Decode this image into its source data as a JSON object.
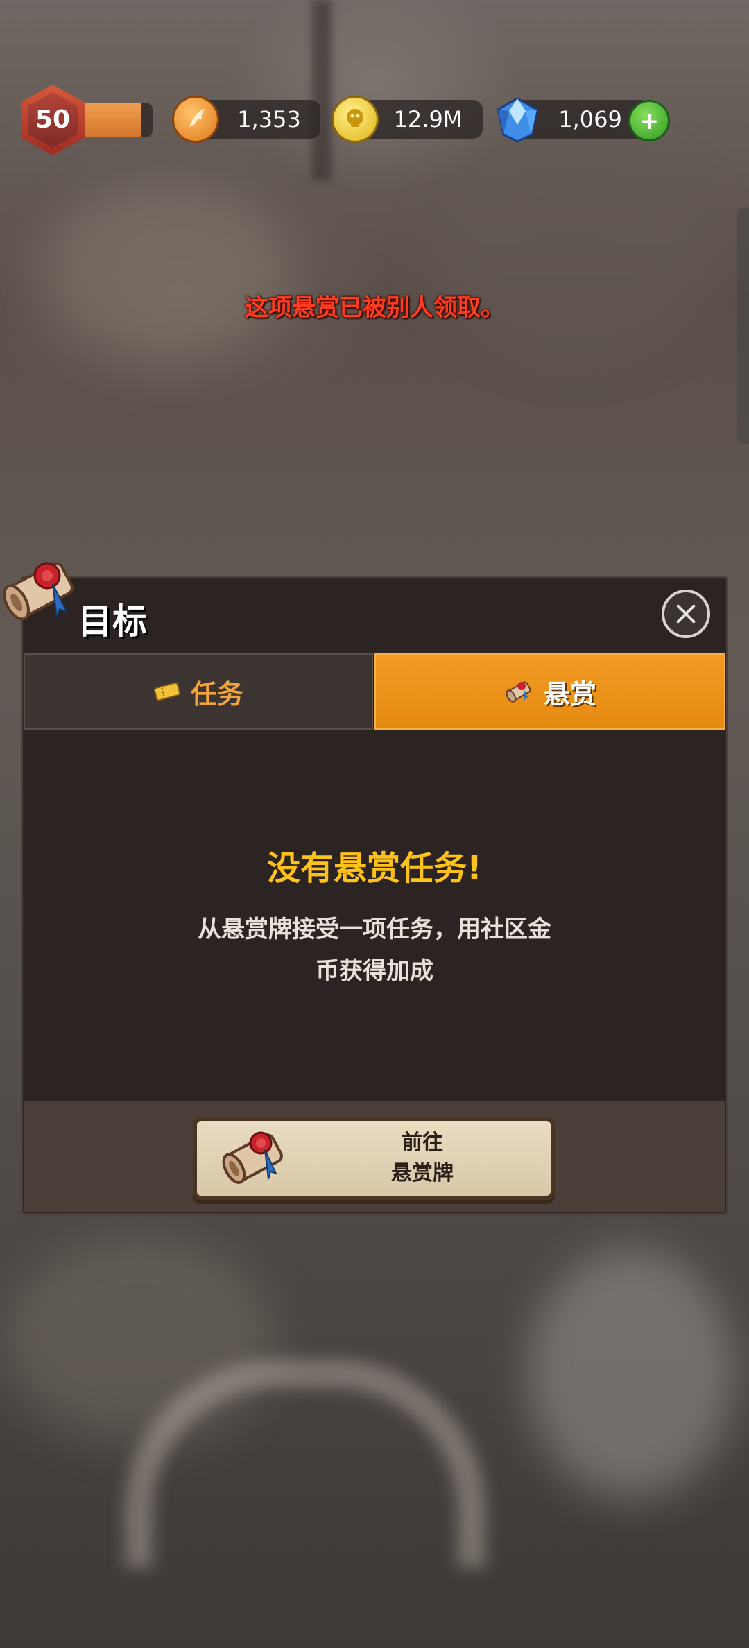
{
  "hud": {
    "level": "50",
    "level_progress": 0.85,
    "wings": "1,353",
    "coins": "12.9M",
    "gems": "1,069",
    "add_label": "+"
  },
  "toast": "这项悬赏已被别人领取。",
  "dialog": {
    "title": "目标",
    "tabs": [
      {
        "label": "任务",
        "icon": "ticket-icon"
      },
      {
        "label": "悬赏",
        "icon": "scroll-icon"
      }
    ],
    "active_tab": 1,
    "empty_title": "没有悬赏任务!",
    "empty_desc_line1": "从悬赏牌接受一项任务，用社区金",
    "empty_desc_line2": "币获得加成",
    "go_button_line1": "前往",
    "go_button_line2": "悬赏牌"
  },
  "colors": {
    "accent_orange": "#e58a10",
    "title_yellow": "#ffc21a",
    "toast_red": "#ff3b20"
  }
}
